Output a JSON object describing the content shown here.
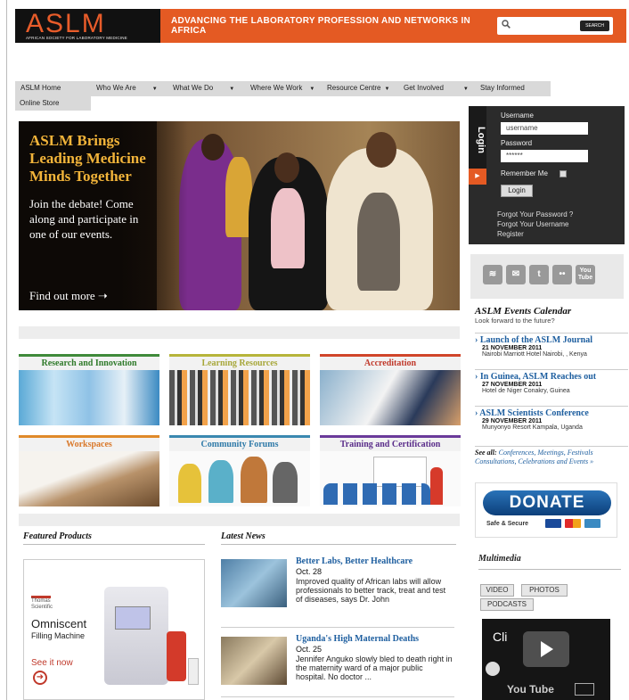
{
  "header": {
    "logo_text": "ASLM",
    "logo_subtitle": "AFRICAN SOCIETY FOR LABORATORY MEDICINE",
    "tagline": "ADVANCING THE LABORATORY PROFESSION AND NETWORKS IN AFRICA",
    "search_button": "SEARCH",
    "accent": "#e45a23"
  },
  "nav": {
    "items": [
      {
        "label": "ASLM Home",
        "dropdown": false
      },
      {
        "label": "Who We Are",
        "dropdown": true
      },
      {
        "label": "What We Do",
        "dropdown": true
      },
      {
        "label": "Where We Work",
        "dropdown": true
      },
      {
        "label": "Resource Centre",
        "dropdown": true
      },
      {
        "label": "Get Involved",
        "dropdown": true
      },
      {
        "label": "Stay Informed",
        "dropdown": true
      },
      {
        "label": "Online Store",
        "dropdown": false
      }
    ],
    "arrow": "▼"
  },
  "hero": {
    "title": "ASLM Brings Leading Medicine Minds Together",
    "body": "Join the debate! Come along and participate in one of our events.",
    "cta": "Find out more"
  },
  "login": {
    "tab": "Login",
    "username_label": "Username",
    "username_value": "username",
    "password_label": "Password",
    "password_value": "******",
    "remember": "Remember Me",
    "button": "Login",
    "forgot_password": "Forgot Your Password ?",
    "forgot_username": "Forgot Your Username",
    "register": "Register"
  },
  "social": {
    "icons": [
      "rss-icon",
      "email-icon",
      "twitter-icon",
      "flickr-icon",
      "youtube-icon"
    ],
    "youtube_label": "You Tube",
    "twitter_label": "t"
  },
  "tiles": [
    {
      "label": "Research and Innovation",
      "color": "#3f8a3a",
      "text_color": "#2f7a2a"
    },
    {
      "label": "Learning Resources",
      "color": "#b6b43a",
      "text_color": "#a7a73a"
    },
    {
      "label": "Accreditation",
      "color": "#d0452a",
      "text_color": "#c0392b"
    },
    {
      "label": "Workspaces",
      "color": "#e08a2a",
      "text_color": "#d9782a"
    },
    {
      "label": "Community Forums",
      "color": "#3a88b0",
      "text_color": "#2f7aa8"
    },
    {
      "label": "Training and Certification",
      "color": "#6a3a9a",
      "text_color": "#5a2d8a"
    }
  ],
  "events": {
    "title": "ASLM Events Calendar",
    "subtitle": "Look forward to the future?",
    "items": [
      {
        "title": "Launch of the ASLM Journal",
        "date": "21 NOVEMBER 2011",
        "place": "Nairobi Marriott Hotel Nairobi, , Kenya"
      },
      {
        "title": "In Guinea, ASLM Reaches out",
        "date": "27 NOVEMBER 2011",
        "place": "Hotel de Niger Conakry, Guinea"
      },
      {
        "title": "ASLM Scientists Conference",
        "date": "29 NOVEMBER 2011",
        "place": "Munyonyo Resort Kampala, Uganda"
      }
    ],
    "see_all_label": "See all:",
    "see_all_links": "Conferences, Meetings, Festivals Consultations, Celebrations and Events »"
  },
  "donate": {
    "label": "DONATE",
    "safe": "Safe & Secure"
  },
  "featured": {
    "title": "Featured Products",
    "brand": "Thomas Scientific",
    "product_name": "Omniscent",
    "product_sub": "Filling Machine",
    "cta": "See it now"
  },
  "news": {
    "title": "Latest News",
    "items": [
      {
        "title": "Better Labs, Better Healthcare",
        "date": "Oct. 28",
        "body": "Improved quality of African labs will allow professionals to better track, treat and test of diseases, says Dr. John"
      },
      {
        "title": "Uganda's High Maternal Deaths",
        "date": "Oct. 25",
        "body": "Jennifer Anguko slowly bled to death right in the maternity ward of a major public hospital. No doctor ..."
      }
    ]
  },
  "multimedia": {
    "title": "Multimedia",
    "tabs": [
      "VIDEO",
      "PHOTOS",
      "PODCASTS"
    ],
    "video_text": "Cli",
    "youtube": "You Tube"
  }
}
